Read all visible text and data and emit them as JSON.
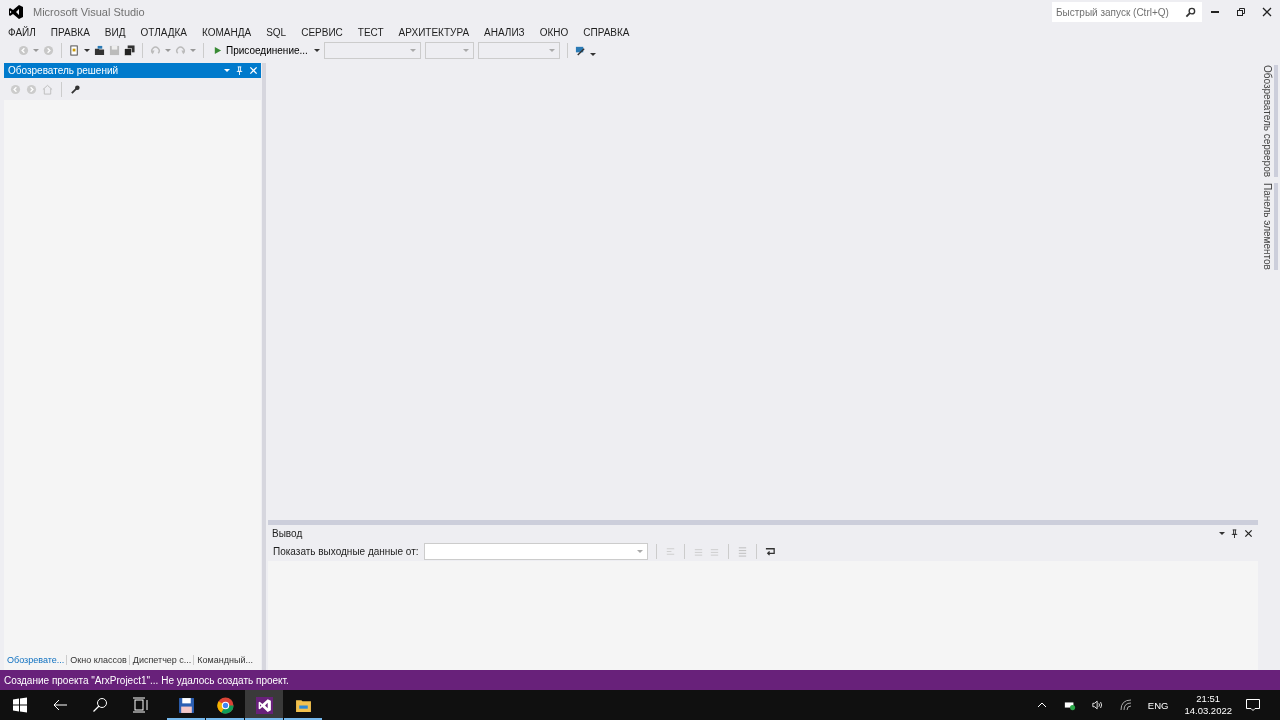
{
  "window": {
    "title": "Microsoft Visual Studio"
  },
  "quick_launch": {
    "placeholder": "Быстрый запуск (Ctrl+Q)"
  },
  "menu": [
    "ФАЙЛ",
    "ПРАВКА",
    "ВИД",
    "ОТЛАДКА",
    "КОМАНДА",
    "SQL",
    "СЕРВИС",
    "ТЕСТ",
    "АРХИТЕКТУРА",
    "АНАЛИЗ",
    "ОКНО",
    "СПРАВКА"
  ],
  "toolbar": {
    "start_button": "Присоединение..."
  },
  "solution_explorer": {
    "title": "Обозреватель решений",
    "tabs": [
      {
        "label": "Обозревате...",
        "selected": true
      },
      {
        "label": "Окно классов",
        "selected": false
      },
      {
        "label": "Диспетчер с...",
        "selected": false
      },
      {
        "label": "Командный...",
        "selected": false
      }
    ]
  },
  "side_tabs": [
    "Обозреватель серверов",
    "Панель элементов"
  ],
  "output": {
    "title": "Вывод",
    "source_label": "Показать выходные данные от:"
  },
  "status_bar": {
    "text": "Создание проекта \"ArxProject1\"... Не удалось создать проект."
  },
  "taskbar": {
    "apps": [
      {
        "kind": "floppy",
        "selected": false
      },
      {
        "kind": "browser",
        "selected": false
      },
      {
        "kind": "vs",
        "selected": true
      },
      {
        "kind": "folder",
        "selected": false
      }
    ],
    "language": "ENG",
    "time": "21:51",
    "date": "14.03.2022"
  }
}
